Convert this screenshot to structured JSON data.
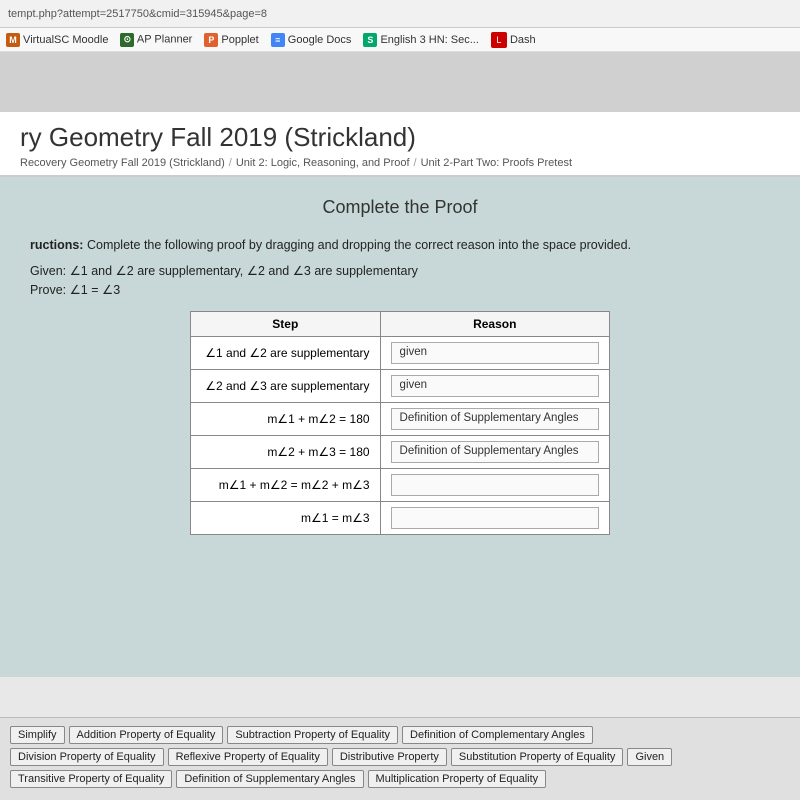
{
  "browser": {
    "url": "tempt.php?attempt=2517750&cmid=315945&page=8",
    "tabs": [
      {
        "name": "VirtualSC Moodle",
        "icon": "M",
        "icon_class": "icon-moodle"
      },
      {
        "name": "AP Planner",
        "icon": "⊙",
        "icon_class": "icon-ap"
      },
      {
        "name": "Popplet",
        "icon": "P",
        "icon_class": "icon-popplet"
      },
      {
        "name": "Google Docs",
        "icon": "≡",
        "icon_class": "icon-gdocs"
      },
      {
        "name": "English 3 HN: Sec...",
        "icon": "S",
        "icon_class": "icon-s"
      },
      {
        "name": "Dash",
        "icon": "L",
        "icon_class": "icon-dash"
      }
    ]
  },
  "page": {
    "title": "ry Geometry Fall 2019 (Strickland)",
    "breadcrumbs": [
      "Recovery Geometry Fall 2019 (Strickland)",
      "Unit 2: Logic, Reasoning, and Proof",
      "Unit 2-Part Two: Proofs Pretest"
    ],
    "proof_title": "Complete the Proof",
    "instructions": "Complete the following proof by dragging and dropping the correct reason into the space provided.",
    "given": "Given: ∠1 and ∠2 are supplementary, ∠2 and ∠3 are supplementary",
    "prove": "Prove: ∠1 = ∠3",
    "table": {
      "headers": [
        "Step",
        "Reason"
      ],
      "rows": [
        {
          "step": "∠1 and ∠2 are supplementary",
          "reason": "given",
          "editable": false
        },
        {
          "step": "∠2 and ∠3 are supplementary",
          "reason": "given",
          "editable": false
        },
        {
          "step": "m∠1 + m∠2 = 180",
          "reason": "Definition of Supplementary Angles",
          "editable": false
        },
        {
          "step": "m∠2 + m∠3 = 180",
          "reason": "Definition of Supplementary Angles",
          "editable": false
        },
        {
          "step": "m∠1 + m∠2 = m∠2 + m∠3",
          "reason": "",
          "editable": true
        },
        {
          "step": "m∠1 = m∠3",
          "reason": "",
          "editable": true
        }
      ]
    },
    "options": [
      [
        "Simplify",
        "Addition Property of Equality",
        "Subtraction Property of Equality",
        "Definition of Complementary Angles"
      ],
      [
        "Division Property of Equality",
        "Reflexive Property of Equality",
        "Distributive Property",
        "Substitution Property of Equality",
        "Given"
      ],
      [
        "Transitive Property of Equality",
        "Definition of Supplementary Angles",
        "Multiplication Property of Equality"
      ]
    ]
  }
}
